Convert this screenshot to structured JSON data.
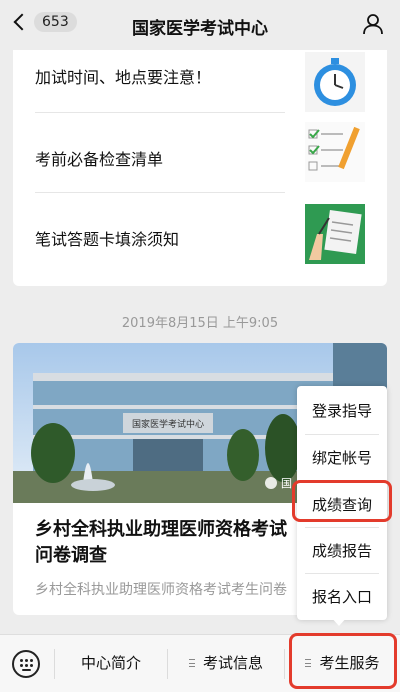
{
  "nav": {
    "back_count": "653",
    "title": "国家医学考试中心"
  },
  "articles": [
    {
      "title": "加试时间、地点要注意！",
      "icon": "stopwatch-thumbnail"
    },
    {
      "title": "考前必备检查清单",
      "icon": "checklist-thumbnail"
    },
    {
      "title": "笔试答题卡填涂须知",
      "icon": "answer-sheet-thumbnail"
    }
  ],
  "timestamp": "2019年8月15日 上午9:05",
  "feature": {
    "title_line1": "乡村全科执业助理医师资格考试",
    "title_line2": "问卷调查",
    "summary": "乡村全科执业助理医师资格考试考生问卷",
    "hero_sign": "国家医学考试中心",
    "watermark": "国"
  },
  "popup_menu": {
    "items": [
      "登录指导",
      "绑定帐号",
      "成绩查询",
      "成绩报告",
      "报名入口"
    ],
    "highlighted": "成绩查询"
  },
  "bottom_bar": {
    "tabs": [
      "中心简介",
      "考试信息",
      "考生服务"
    ],
    "highlighted": "考生服务"
  },
  "colors": {
    "highlight": "#e33b2c",
    "background": "#ededed"
  }
}
